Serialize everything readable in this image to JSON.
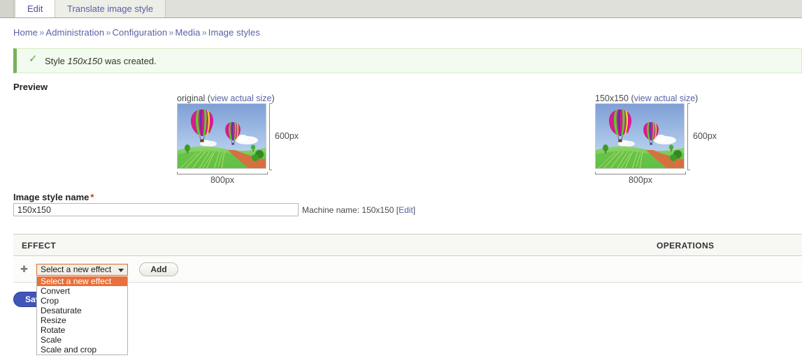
{
  "tabs": [
    {
      "label": "Edit",
      "active": true
    },
    {
      "label": "Translate image style",
      "active": false
    }
  ],
  "breadcrumb": {
    "items": [
      "Home",
      "Administration",
      "Configuration",
      "Media",
      "Image styles"
    ],
    "separator": "»"
  },
  "status_message": {
    "icon": "check-icon",
    "prefix": "Style ",
    "emphasis": "150x150",
    "suffix": " was created.",
    "accent_color": "#77b259",
    "background_color": "#f3faef"
  },
  "preview": {
    "heading": "Preview",
    "original": {
      "caption_name": "original",
      "link_text": "view actual size",
      "width_label": "800px",
      "height_label": "600px"
    },
    "derivative": {
      "caption_name": "150x150",
      "link_text": "view actual size",
      "width_label": "800px",
      "height_label": "600px"
    }
  },
  "form": {
    "name_label": "Image style name",
    "required_marker": "*",
    "name_value": "150x150",
    "name_placeholder": "",
    "machine_name_prefix": "Machine name: ",
    "machine_name_value": "150x150",
    "machine_name_edit": "Edit",
    "machine_name_bracket_open": " [",
    "machine_name_bracket_close": "]"
  },
  "effects_table": {
    "columns": [
      "EFFECT",
      "OPERATIONS"
    ],
    "row": {
      "drag_handle_icon": "drag-move-icon",
      "select_value": "Select a new effect",
      "add_button": "Add"
    }
  },
  "effect_dropdown": {
    "open": true,
    "selected": "Select a new effect",
    "highlight_color": "#e8703a",
    "options": [
      "Select a new effect",
      "Convert",
      "Crop",
      "Desaturate",
      "Resize",
      "Rotate",
      "Scale",
      "Scale and crop"
    ]
  },
  "actions": {
    "save_label": "Save",
    "save_color": "#4055b8"
  }
}
